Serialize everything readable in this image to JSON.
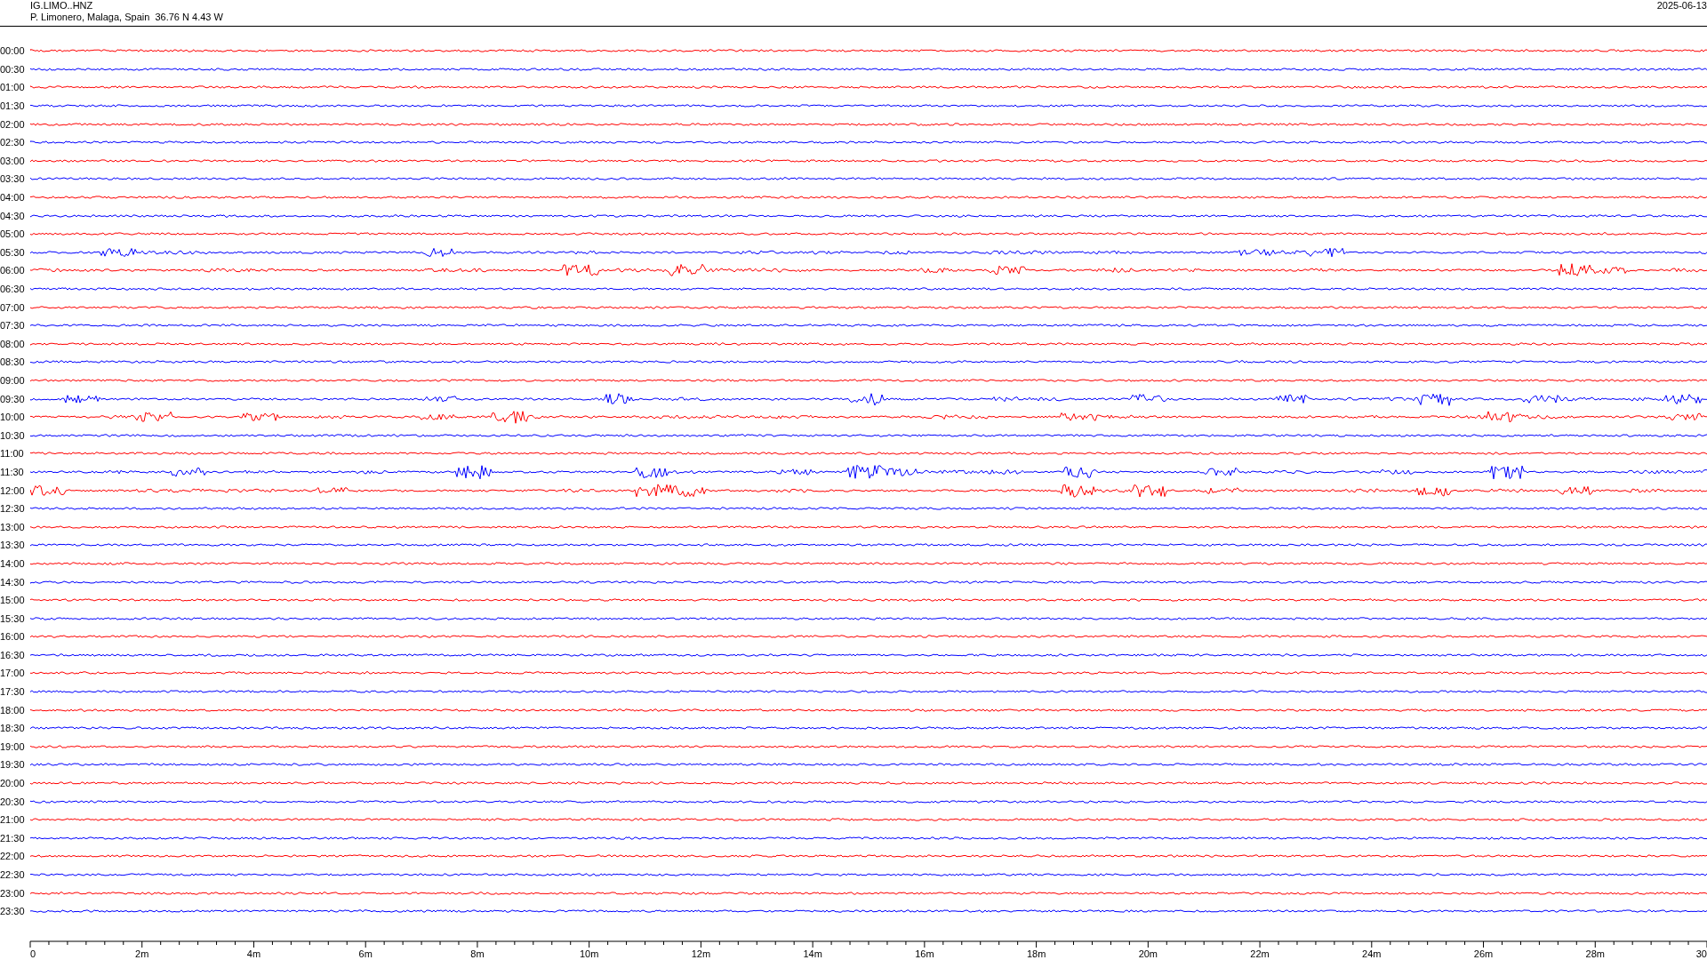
{
  "header": {
    "station": "IG.LIMO..HNZ",
    "location": "P. Limonero, Malaga, Spain  36.76 N 4.43 W",
    "date": "2025-06-13"
  },
  "rows": [
    {
      "label": "00:00",
      "color": "#ff0000",
      "kind": "quiet"
    },
    {
      "label": "00:30",
      "color": "#0000ff",
      "kind": "quiet"
    },
    {
      "label": "01:00",
      "color": "#ff0000",
      "kind": "quiet"
    },
    {
      "label": "01:30",
      "color": "#0000ff",
      "kind": "quiet"
    },
    {
      "label": "02:00",
      "color": "#ff0000",
      "kind": "quiet"
    },
    {
      "label": "02:30",
      "color": "#0000ff",
      "kind": "quiet"
    },
    {
      "label": "03:00",
      "color": "#ff0000",
      "kind": "quiet"
    },
    {
      "label": "03:30",
      "color": "#0000ff",
      "kind": "quiet"
    },
    {
      "label": "04:00",
      "color": "#ff0000",
      "kind": "quiet"
    },
    {
      "label": "04:30",
      "color": "#0000ff",
      "kind": "quiet"
    },
    {
      "label": "05:00",
      "color": "#ff0000",
      "kind": "quiet"
    },
    {
      "label": "05:30",
      "color": "#0000ff",
      "kind": "busy"
    },
    {
      "label": "06:00",
      "color": "#ff0000",
      "kind": "busy"
    },
    {
      "label": "06:30",
      "color": "#0000ff",
      "kind": "quiet"
    },
    {
      "label": "07:00",
      "color": "#ff0000",
      "kind": "quiet"
    },
    {
      "label": "07:30",
      "color": "#0000ff",
      "kind": "quiet"
    },
    {
      "label": "08:00",
      "color": "#ff0000",
      "kind": "quiet"
    },
    {
      "label": "08:30",
      "color": "#0000ff",
      "kind": "quiet"
    },
    {
      "label": "09:00",
      "color": "#ff0000",
      "kind": "quiet"
    },
    {
      "label": "09:30",
      "color": "#0000ff",
      "kind": "busy"
    },
    {
      "label": "10:00",
      "color": "#ff0000",
      "kind": "busy"
    },
    {
      "label": "10:30",
      "color": "#0000ff",
      "kind": "quiet"
    },
    {
      "label": "11:00",
      "color": "#ff0000",
      "kind": "quiet"
    },
    {
      "label": "11:30",
      "color": "#0000ff",
      "kind": "busy"
    },
    {
      "label": "12:00",
      "color": "#ff0000",
      "kind": "busy"
    },
    {
      "label": "12:30",
      "color": "#0000ff",
      "kind": "quiet"
    },
    {
      "label": "13:00",
      "color": "#ff0000",
      "kind": "quiet"
    },
    {
      "label": "13:30",
      "color": "#0000ff",
      "kind": "quiet"
    },
    {
      "label": "14:00",
      "color": "#ff0000",
      "kind": "quiet"
    },
    {
      "label": "14:30",
      "color": "#0000ff",
      "kind": "quiet"
    },
    {
      "label": "15:00",
      "color": "#ff0000",
      "kind": "quiet"
    },
    {
      "label": "15:30",
      "color": "#0000ff",
      "kind": "quiet"
    },
    {
      "label": "16:00",
      "color": "#ff0000",
      "kind": "quiet"
    },
    {
      "label": "16:30",
      "color": "#0000ff",
      "kind": "quiet"
    },
    {
      "label": "17:00",
      "color": "#ff0000",
      "kind": "quiet"
    },
    {
      "label": "17:30",
      "color": "#0000ff",
      "kind": "quiet"
    },
    {
      "label": "18:00",
      "color": "#ff0000",
      "kind": "quiet"
    },
    {
      "label": "18:30",
      "color": "#0000ff",
      "kind": "quiet"
    },
    {
      "label": "19:00",
      "color": "#ff0000",
      "kind": "quiet"
    },
    {
      "label": "19:30",
      "color": "#0000ff",
      "kind": "quiet"
    },
    {
      "label": "20:00",
      "color": "#ff0000",
      "kind": "quiet"
    },
    {
      "label": "20:30",
      "color": "#0000ff",
      "kind": "quiet"
    },
    {
      "label": "21:00",
      "color": "#ff0000",
      "kind": "quiet"
    },
    {
      "label": "21:30",
      "color": "#0000ff",
      "kind": "quiet"
    },
    {
      "label": "22:00",
      "color": "#ff0000",
      "kind": "quiet"
    },
    {
      "label": "22:30",
      "color": "#0000ff",
      "kind": "quiet"
    },
    {
      "label": "23:00",
      "color": "#ff0000",
      "kind": "quiet"
    },
    {
      "label": "23:30",
      "color": "#0000ff",
      "kind": "quiet"
    }
  ],
  "axis_labels": [
    "0",
    "2m",
    "4m",
    "6m",
    "8m",
    "10m",
    "12m",
    "14m",
    "16m",
    "18m",
    "20m",
    "22m",
    "24m",
    "26m",
    "28m",
    "30"
  ]
}
